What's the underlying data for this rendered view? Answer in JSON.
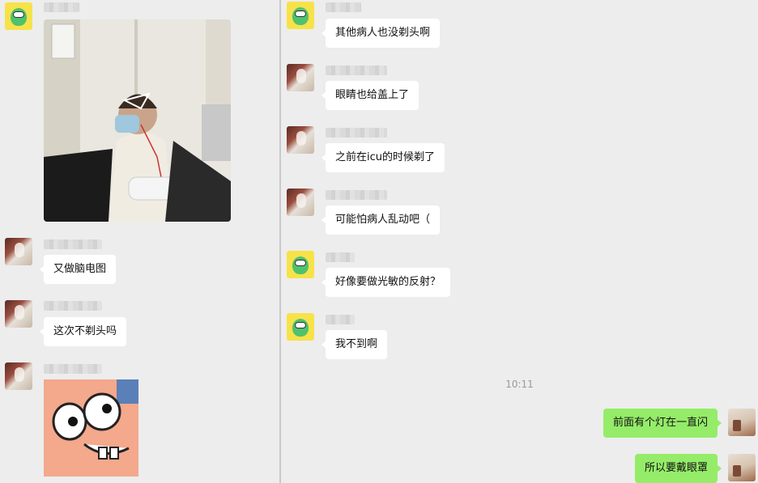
{
  "left_chat": {
    "messages": [
      {
        "type": "image",
        "description_icon": "photo",
        "sender": "other"
      },
      {
        "type": "text",
        "text": "又做脑电图",
        "sender": "other"
      },
      {
        "type": "text",
        "text": "这次不剃头吗",
        "sender": "other"
      },
      {
        "type": "sticker",
        "sender": "other"
      }
    ]
  },
  "right_chat": {
    "messages": [
      {
        "text": "其他病人也没剃头啊",
        "sender": "other"
      },
      {
        "text": "眼睛也给盖上了",
        "sender": "other"
      },
      {
        "text": "之前在icu的时候剃了",
        "sender": "other"
      },
      {
        "text": "可能怕病人乱动吧（",
        "sender": "other"
      },
      {
        "text": "好像要做光敏的反射？",
        "sender": "other"
      },
      {
        "text": "我不到啊",
        "sender": "other"
      }
    ],
    "timestamp": "10:11",
    "my_messages": [
      {
        "text": "前面有个灯在一直闪",
        "sender": "self"
      },
      {
        "text": "所以要戴眼罩",
        "sender": "self"
      }
    ]
  },
  "colors": {
    "background": "#ededed",
    "incoming_bubble": "#ffffff",
    "outgoing_bubble": "#95ec69",
    "divider": "#c9c9c9"
  }
}
